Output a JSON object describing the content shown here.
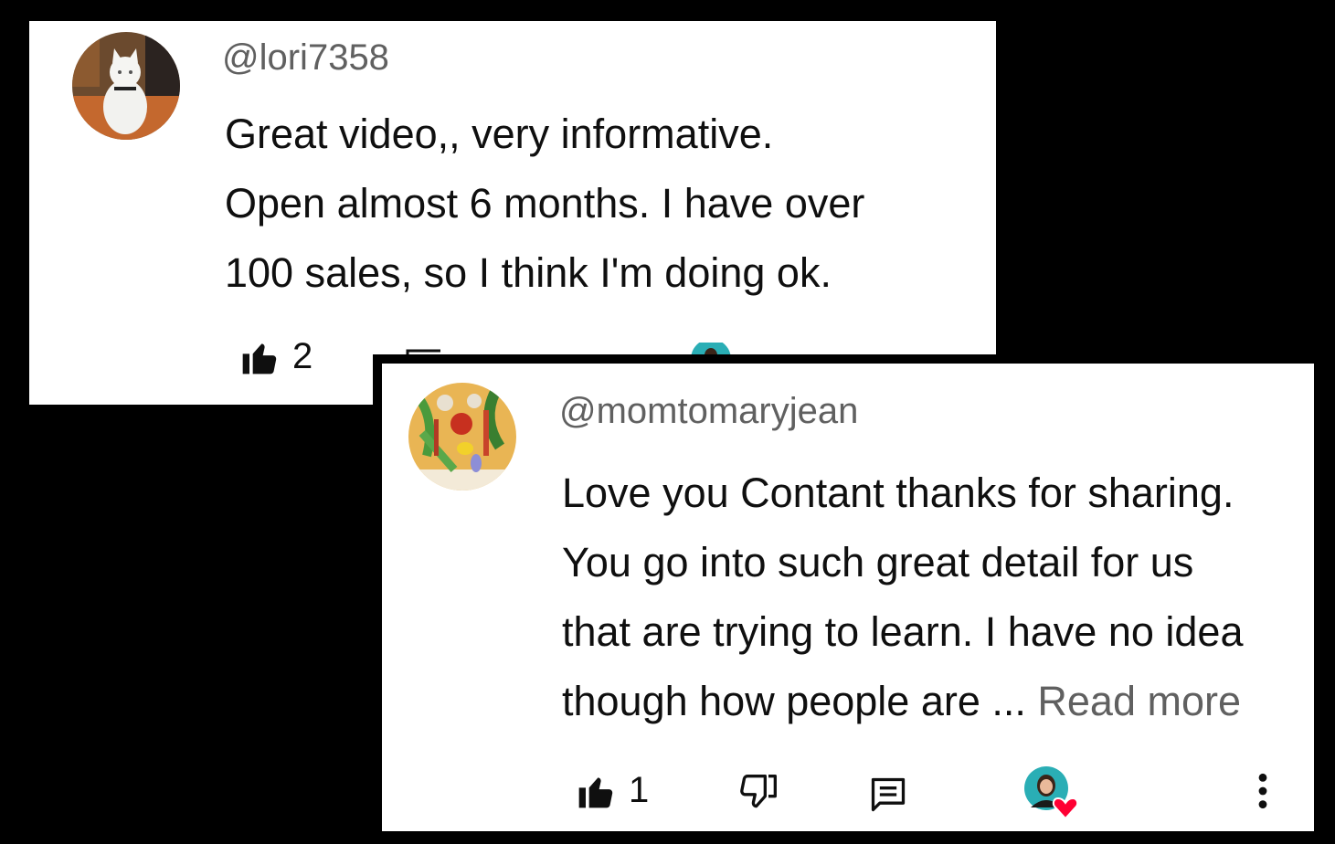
{
  "comments": [
    {
      "author": "@lori7358",
      "body_lines": [
        "Great video,, very informative.",
        "Open almost 6 months. I have over",
        "100 sales, so I think I'm doing ok."
      ],
      "like_count": "2",
      "avatar_icon": "white-cat-avatar"
    },
    {
      "author": "@momtomaryjean",
      "body_lines": [
        "Love you Contant thanks for sharing.",
        "You go into such great detail for us",
        "that are trying to learn. I have no idea",
        "though how people are ..."
      ],
      "read_more": "Read more",
      "like_count": "1",
      "avatar_icon": "vegetables-avatar"
    }
  ],
  "colors": {
    "background": "#000000",
    "card": "#ffffff",
    "text": "#0f0f0f",
    "muted": "#606060",
    "heart": "#ff0033"
  }
}
